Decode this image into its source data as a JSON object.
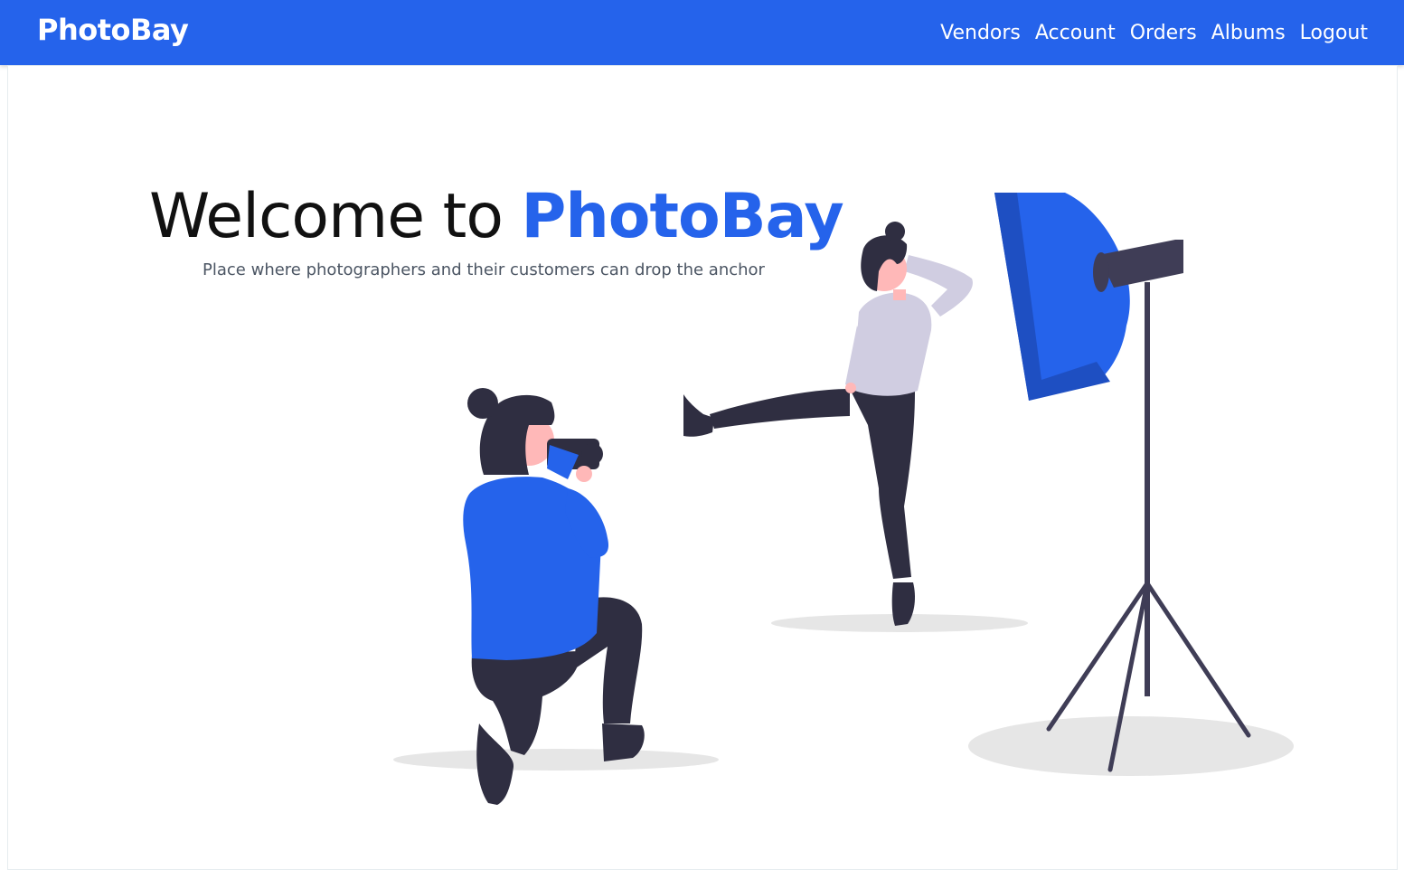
{
  "nav": {
    "brand": "PhotoBay",
    "links": [
      "Vendors",
      "Account",
      "Orders",
      "Albums",
      "Logout"
    ]
  },
  "hero": {
    "title_prefix": "Welcome to ",
    "title_accent": "PhotoBay",
    "subtitle": "Place where photographers and their customers can drop the anchor"
  },
  "colors": {
    "brand_blue": "#2563eb",
    "dark": "#2f2e41",
    "shirt_light": "#d0cde1",
    "skin": "#ffb8b8",
    "shadow": "#e6e6e6"
  }
}
